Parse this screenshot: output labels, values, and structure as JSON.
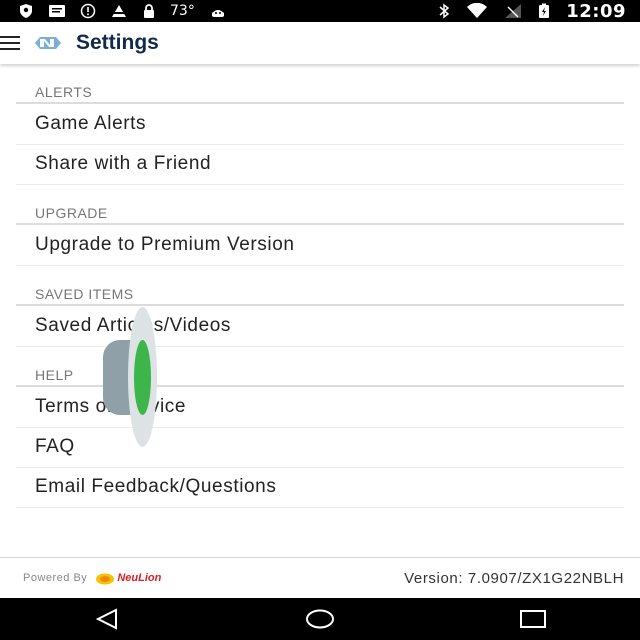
{
  "status_bar": {
    "temperature": "73°",
    "time": "12:09"
  },
  "app_bar": {
    "title": "Settings"
  },
  "sections": [
    {
      "header": "ALERTS",
      "items": [
        "Game Alerts",
        "Share with a Friend"
      ]
    },
    {
      "header": "UPGRADE",
      "items": [
        "Upgrade to Premium Version"
      ]
    },
    {
      "header": "SAVED ITEMS",
      "items": [
        "Saved Articles/Videos"
      ]
    },
    {
      "header": "HELP",
      "items": [
        "Terms of Service",
        "FAQ",
        "Email Feedback/Questions"
      ]
    }
  ],
  "footer": {
    "powered_by": "Powered By",
    "brand": "NeuLion",
    "version": "Version: 7.0907/ZX1G22NBLH"
  },
  "colors": {
    "title": "#13294b",
    "accent_green": "#3cb54a",
    "brand_red": "#d6202a"
  }
}
